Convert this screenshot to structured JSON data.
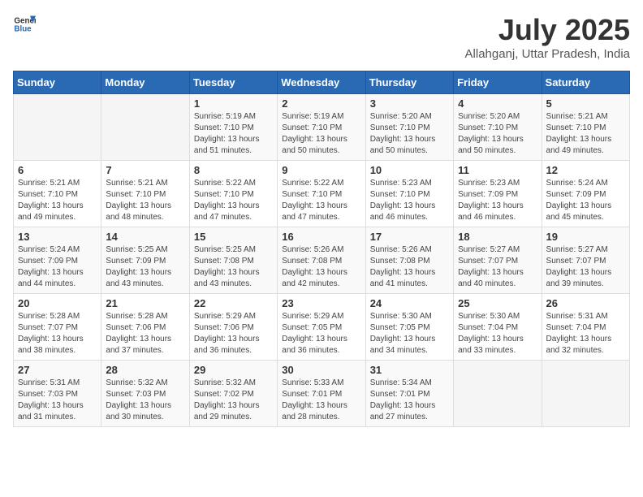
{
  "header": {
    "logo_general": "General",
    "logo_blue": "Blue",
    "month_year": "July 2025",
    "location": "Allahganj, Uttar Pradesh, India"
  },
  "weekdays": [
    "Sunday",
    "Monday",
    "Tuesday",
    "Wednesday",
    "Thursday",
    "Friday",
    "Saturday"
  ],
  "weeks": [
    [
      {
        "day": "",
        "text": ""
      },
      {
        "day": "",
        "text": ""
      },
      {
        "day": "1",
        "text": "Sunrise: 5:19 AM\nSunset: 7:10 PM\nDaylight: 13 hours\nand 51 minutes."
      },
      {
        "day": "2",
        "text": "Sunrise: 5:19 AM\nSunset: 7:10 PM\nDaylight: 13 hours\nand 50 minutes."
      },
      {
        "day": "3",
        "text": "Sunrise: 5:20 AM\nSunset: 7:10 PM\nDaylight: 13 hours\nand 50 minutes."
      },
      {
        "day": "4",
        "text": "Sunrise: 5:20 AM\nSunset: 7:10 PM\nDaylight: 13 hours\nand 50 minutes."
      },
      {
        "day": "5",
        "text": "Sunrise: 5:21 AM\nSunset: 7:10 PM\nDaylight: 13 hours\nand 49 minutes."
      }
    ],
    [
      {
        "day": "6",
        "text": "Sunrise: 5:21 AM\nSunset: 7:10 PM\nDaylight: 13 hours\nand 49 minutes."
      },
      {
        "day": "7",
        "text": "Sunrise: 5:21 AM\nSunset: 7:10 PM\nDaylight: 13 hours\nand 48 minutes."
      },
      {
        "day": "8",
        "text": "Sunrise: 5:22 AM\nSunset: 7:10 PM\nDaylight: 13 hours\nand 47 minutes."
      },
      {
        "day": "9",
        "text": "Sunrise: 5:22 AM\nSunset: 7:10 PM\nDaylight: 13 hours\nand 47 minutes."
      },
      {
        "day": "10",
        "text": "Sunrise: 5:23 AM\nSunset: 7:10 PM\nDaylight: 13 hours\nand 46 minutes."
      },
      {
        "day": "11",
        "text": "Sunrise: 5:23 AM\nSunset: 7:09 PM\nDaylight: 13 hours\nand 46 minutes."
      },
      {
        "day": "12",
        "text": "Sunrise: 5:24 AM\nSunset: 7:09 PM\nDaylight: 13 hours\nand 45 minutes."
      }
    ],
    [
      {
        "day": "13",
        "text": "Sunrise: 5:24 AM\nSunset: 7:09 PM\nDaylight: 13 hours\nand 44 minutes."
      },
      {
        "day": "14",
        "text": "Sunrise: 5:25 AM\nSunset: 7:09 PM\nDaylight: 13 hours\nand 43 minutes."
      },
      {
        "day": "15",
        "text": "Sunrise: 5:25 AM\nSunset: 7:08 PM\nDaylight: 13 hours\nand 43 minutes."
      },
      {
        "day": "16",
        "text": "Sunrise: 5:26 AM\nSunset: 7:08 PM\nDaylight: 13 hours\nand 42 minutes."
      },
      {
        "day": "17",
        "text": "Sunrise: 5:26 AM\nSunset: 7:08 PM\nDaylight: 13 hours\nand 41 minutes."
      },
      {
        "day": "18",
        "text": "Sunrise: 5:27 AM\nSunset: 7:07 PM\nDaylight: 13 hours\nand 40 minutes."
      },
      {
        "day": "19",
        "text": "Sunrise: 5:27 AM\nSunset: 7:07 PM\nDaylight: 13 hours\nand 39 minutes."
      }
    ],
    [
      {
        "day": "20",
        "text": "Sunrise: 5:28 AM\nSunset: 7:07 PM\nDaylight: 13 hours\nand 38 minutes."
      },
      {
        "day": "21",
        "text": "Sunrise: 5:28 AM\nSunset: 7:06 PM\nDaylight: 13 hours\nand 37 minutes."
      },
      {
        "day": "22",
        "text": "Sunrise: 5:29 AM\nSunset: 7:06 PM\nDaylight: 13 hours\nand 36 minutes."
      },
      {
        "day": "23",
        "text": "Sunrise: 5:29 AM\nSunset: 7:05 PM\nDaylight: 13 hours\nand 36 minutes."
      },
      {
        "day": "24",
        "text": "Sunrise: 5:30 AM\nSunset: 7:05 PM\nDaylight: 13 hours\nand 34 minutes."
      },
      {
        "day": "25",
        "text": "Sunrise: 5:30 AM\nSunset: 7:04 PM\nDaylight: 13 hours\nand 33 minutes."
      },
      {
        "day": "26",
        "text": "Sunrise: 5:31 AM\nSunset: 7:04 PM\nDaylight: 13 hours\nand 32 minutes."
      }
    ],
    [
      {
        "day": "27",
        "text": "Sunrise: 5:31 AM\nSunset: 7:03 PM\nDaylight: 13 hours\nand 31 minutes."
      },
      {
        "day": "28",
        "text": "Sunrise: 5:32 AM\nSunset: 7:03 PM\nDaylight: 13 hours\nand 30 minutes."
      },
      {
        "day": "29",
        "text": "Sunrise: 5:32 AM\nSunset: 7:02 PM\nDaylight: 13 hours\nand 29 minutes."
      },
      {
        "day": "30",
        "text": "Sunrise: 5:33 AM\nSunset: 7:01 PM\nDaylight: 13 hours\nand 28 minutes."
      },
      {
        "day": "31",
        "text": "Sunrise: 5:34 AM\nSunset: 7:01 PM\nDaylight: 13 hours\nand 27 minutes."
      },
      {
        "day": "",
        "text": ""
      },
      {
        "day": "",
        "text": ""
      }
    ]
  ]
}
